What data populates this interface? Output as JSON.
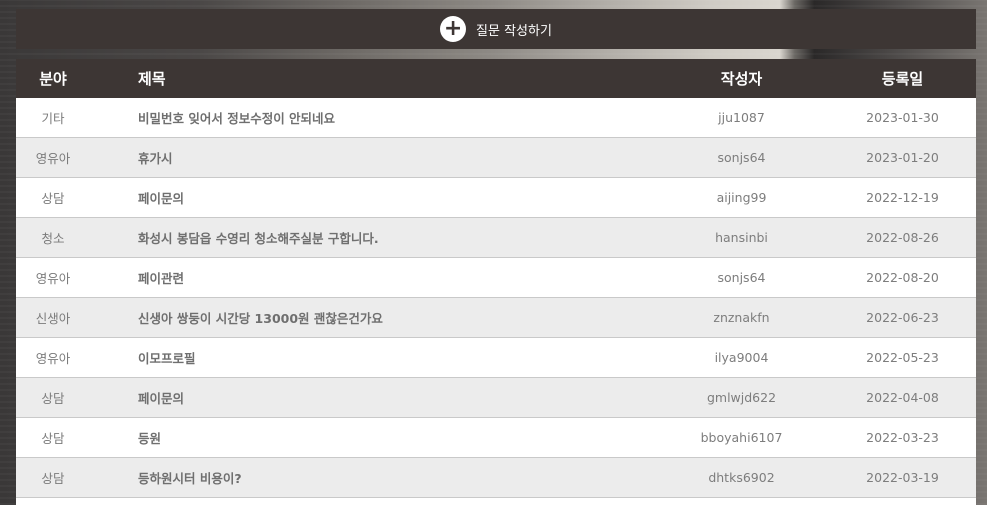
{
  "write_button": {
    "label": "질문 작성하기",
    "icon": "plus-circle-icon"
  },
  "table": {
    "headers": {
      "category": "분야",
      "title": "제목",
      "author": "작성자",
      "date": "등록일"
    },
    "rows": [
      {
        "category": "기타",
        "title": "비밀번호 잊어서 정보수정이 안되네요",
        "author": "jju1087",
        "date": "2023-01-30"
      },
      {
        "category": "영유아",
        "title": "휴가시",
        "author": "sonjs64",
        "date": "2023-01-20"
      },
      {
        "category": "상담",
        "title": "페이문의",
        "author": "aijing99",
        "date": "2022-12-19"
      },
      {
        "category": "청소",
        "title": "화성시 봉담읍 수영리 청소해주실분 구합니다.",
        "author": "hansinbi",
        "date": "2022-08-26"
      },
      {
        "category": "영유아",
        "title": "페이관련",
        "author": "sonjs64",
        "date": "2022-08-20"
      },
      {
        "category": "신생아",
        "title": "신생아 쌍둥이 시간당 13000원 괜찮은건가요",
        "author": "znznakfn",
        "date": "2022-06-23"
      },
      {
        "category": "영유아",
        "title": "이모프로필",
        "author": "ilya9004",
        "date": "2022-05-23"
      },
      {
        "category": "상담",
        "title": "페이문의",
        "author": "gmlwjd622",
        "date": "2022-04-08"
      },
      {
        "category": "상담",
        "title": "등원",
        "author": "bboyahi6107",
        "date": "2022-03-23"
      },
      {
        "category": "상담",
        "title": "등하원시터 비용이?",
        "author": "dhtks6902",
        "date": "2022-03-19"
      }
    ]
  }
}
